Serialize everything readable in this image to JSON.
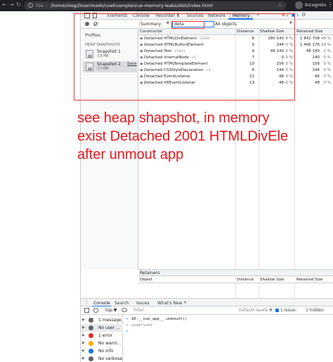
{
  "browser": {
    "back_icon": "←",
    "forward_icon": "→",
    "reload_icon": "↻",
    "info_icon": "i",
    "scheme_label": "File",
    "separator": "|",
    "url": "/home/oleg/Downloads/vueExample/vue-memory-leaks/dist/index.html",
    "star_icon": "☆",
    "profile_label": "Incognito",
    "menu_icon": "⋮"
  },
  "devtools": {
    "tabs": [
      {
        "label": "Elements"
      },
      {
        "label": "Console"
      },
      {
        "label": "Recorder ⬆"
      },
      {
        "label": "Sources"
      },
      {
        "label": "Network"
      },
      {
        "label": "Memory"
      }
    ],
    "more_tabs": "»",
    "error_badge": "⊗ 1",
    "message_badge": "■ 1",
    "settings_icon": "⚙",
    "toolbar": {
      "view_select": "Summary",
      "view_caret": "▼",
      "class_filter_value": "deta",
      "object_select": "All objects",
      "object_caret": "▼"
    },
    "profiles": {
      "header": "Profiles",
      "section": "HEAP SNAPSHOTS",
      "snapshots": [
        {
          "name": "Snapshot 1",
          "size": "3.8 MB",
          "action": ""
        },
        {
          "name": "Snapshot 2",
          "size": "3.7 MB",
          "action": "Save"
        }
      ]
    },
    "table": {
      "columns": {
        "constructor": "Constructor",
        "distance": "Distance",
        "shallow": "Shallow Size",
        "retained": "Retained Size"
      },
      "rows": [
        {
          "name": "Detached HTMLDivElement",
          "count": "×2001",
          "distance": "8",
          "shallow": "280 140",
          "shallow_pct": "8 %",
          "retained": "1 842 708",
          "retained_pct": "49 %"
        },
        {
          "name": "Detached HTMLButtonElement",
          "count": "",
          "distance": "9",
          "shallow": "244",
          "shallow_pct": "0 %",
          "retained": "1 466 176",
          "retained_pct": "39 %"
        },
        {
          "name": "Detached Text",
          "count": "×1003",
          "distance": "9",
          "shallow": "48 140",
          "shallow_pct": "1 %",
          "retained": "48 140",
          "retained_pct": "1 %"
        },
        {
          "name": "Detached InternalNode",
          "count": "×5",
          "distance": "7",
          "shallow": "0",
          "shallow_pct": "0 %",
          "retained": "240",
          "retained_pct": "0 %"
        },
        {
          "name": "Detached HTMLTemplateElement",
          "count": "",
          "distance": "10",
          "shallow": "156",
          "shallow_pct": "0 %",
          "retained": "156",
          "retained_pct": "0 %"
        },
        {
          "name": "Detached CSSStyleDeclaration",
          "count": "×3",
          "distance": "8",
          "shallow": "144",
          "shallow_pct": "0 %",
          "retained": "144",
          "retained_pct": "0 %"
        },
        {
          "name": "Detached EventListener",
          "count": "",
          "distance": "12",
          "shallow": "48",
          "shallow_pct": "0 %",
          "retained": "96",
          "retained_pct": "0 %"
        },
        {
          "name": "Detached V8EventListener",
          "count": "",
          "distance": "13",
          "shallow": "48",
          "shallow_pct": "0 %",
          "retained": "48",
          "retained_pct": "0 %"
        }
      ]
    },
    "retainers": {
      "title": "Retainers",
      "columns": {
        "object": "Object",
        "distance": "Distance",
        "shallow": "Shallow Size",
        "retained": "Retained Size"
      }
    }
  },
  "annotation": {
    "lines": [
      "see heap shapshot, in memory",
      "exist Detached 2001 HTMLDivEle",
      "after unmout app"
    ]
  },
  "drawer": {
    "menu_icon": "⋮",
    "tabs": [
      {
        "label": "Console"
      },
      {
        "label": "Search"
      },
      {
        "label": "Issues"
      },
      {
        "label": "What's New"
      }
    ],
    "close_icon": "✕",
    "toolbar": {
      "context": "top ▼",
      "filter_placeholder": "Filter",
      "levels": "Default levels ▼",
      "issues": "1 Issue:",
      "issue_count": "■ 1",
      "hidden": "1 hidden"
    },
    "sidebar": [
      {
        "label": "1 message",
        "icon": "list-icon",
        "color": "#5f6368"
      },
      {
        "label": "No user ...",
        "icon": "user-icon",
        "color": "#5f6368"
      },
      {
        "label": "1 error",
        "icon": "error-icon",
        "color": "#d93025"
      },
      {
        "label": "No warni...",
        "icon": "warning-icon",
        "color": "#f9ab00"
      },
      {
        "label": "No info",
        "icon": "info-icon",
        "color": "#1a73e8"
      },
      {
        "label": "No verbose",
        "icon": "verbose-icon",
        "color": "#5f6368"
      }
    ],
    "output": [
      {
        "prompt": ">",
        "text": "$0.__vue_app__.unmount()"
      },
      {
        "prompt": "<·",
        "text": "undefined"
      },
      {
        "prompt": ">",
        "text": ""
      }
    ]
  }
}
